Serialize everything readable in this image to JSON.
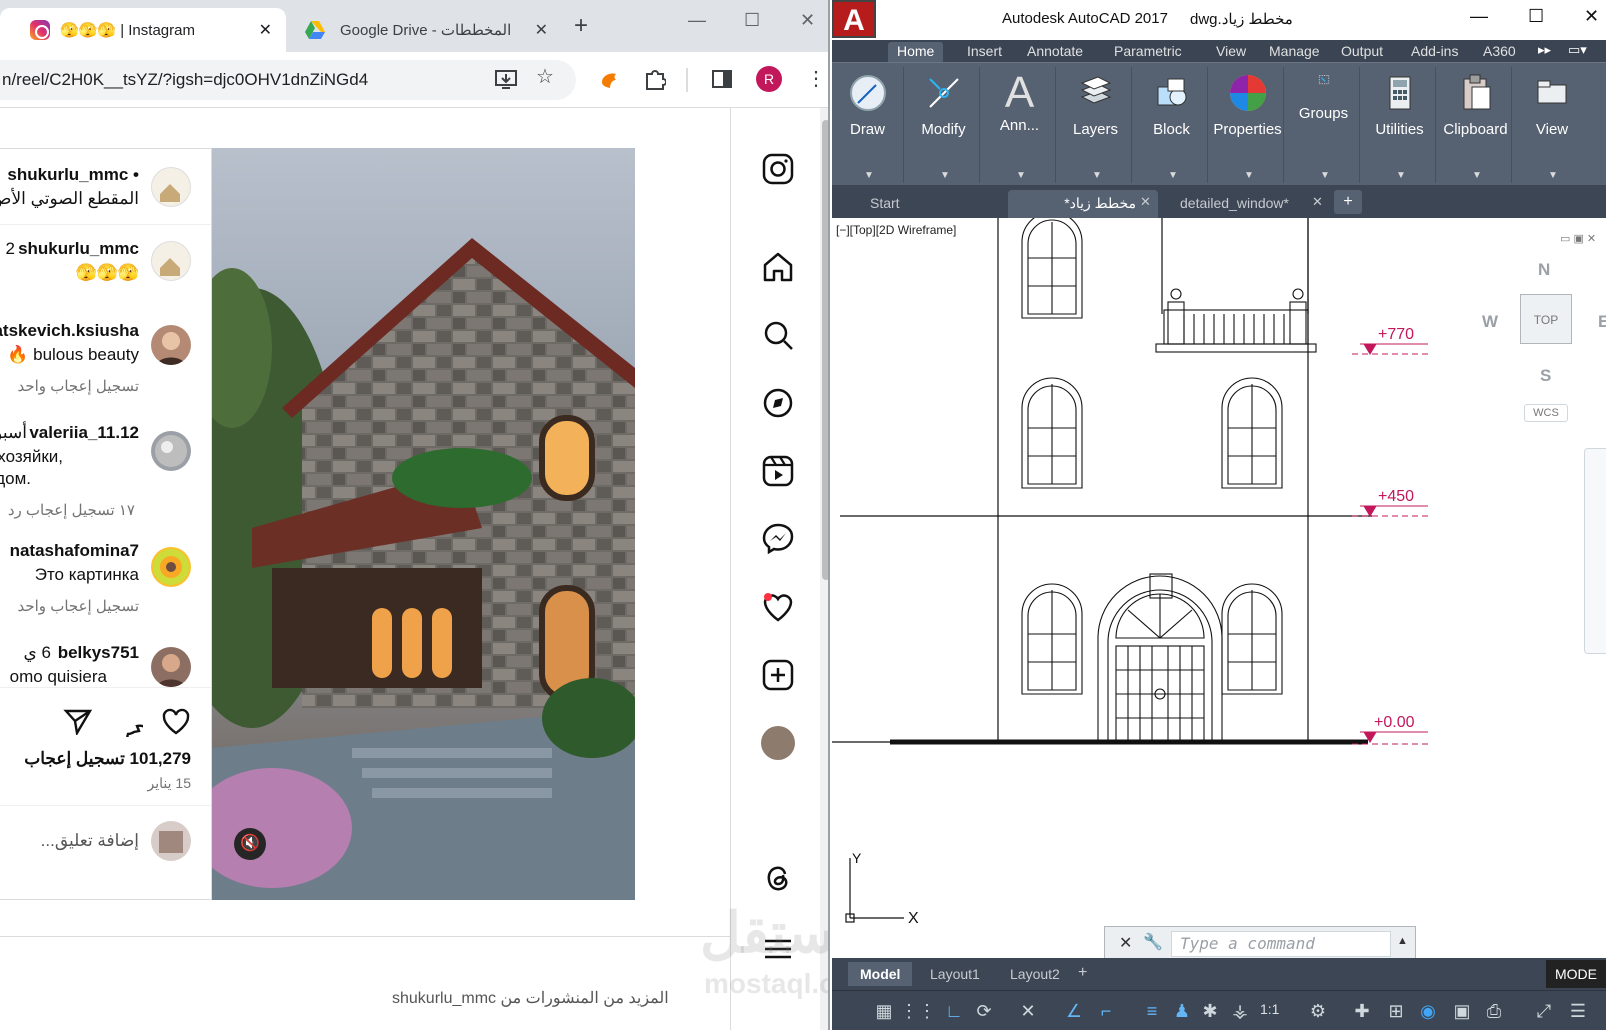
{
  "browser": {
    "tabs": [
      {
        "title": "🫣🫣🫣 | Instagram",
        "close": "✕"
      },
      {
        "title": "Google Drive - المخططات",
        "close": "✕"
      }
    ],
    "new_tab": "+",
    "window_controls": [
      "—",
      "☐",
      "✕"
    ],
    "url": "n/reel/C2H0K__tsYZ/?igsh=djc0OHV1dnZiNGd4",
    "profile_initial": "R"
  },
  "instagram": {
    "comments": [
      {
        "user": "shukurlu_mmc •",
        "text": "المقطع الصوتي الأص",
        "meta": ""
      },
      {
        "user": "shukurlu_mmc",
        "prefix": "2",
        "text": "🫣🫣🫣",
        "meta": ""
      },
      {
        "user": "atskevich.ksiusha",
        "text": "bulous beauty 🔥",
        "meta": "تسجيل إعجاب واحد"
      },
      {
        "user": "valeriia_11.12",
        "suffix": "أسبو",
        "text": "хозяйки,",
        "text2": "дом.",
        "meta": "١٧ تسجيل إعجاب   رد"
      },
      {
        "user": "natashafomina7",
        "text": "Это картинка",
        "meta": "تسجيل إعجاب واحد"
      },
      {
        "user": "belkys751",
        "suffix": "6 ي",
        "text": "omo quisiera",
        "meta": ""
      }
    ],
    "likes": "101,279 تسجيل إعجاب",
    "date": "15 يناير",
    "add_comment_placeholder": "إضافة تعليق...",
    "more_posts": "المزيد من المنشورات من shukurlu_mmc",
    "sidebar_icons": [
      "instagram-icon",
      "home-icon",
      "search-icon",
      "explore-icon",
      "reels-icon",
      "messenger-icon",
      "notifications-icon",
      "create-icon",
      "profile-icon",
      "threads-icon",
      "more-icon"
    ]
  },
  "autocad": {
    "title": "Autodesk AutoCAD 2017",
    "file": "مخطط زياد.dwg",
    "ribbon_tabs": [
      "Home",
      "Insert",
      "Annotate",
      "Parametric",
      "View",
      "Manage",
      "Output",
      "Add-ins",
      "A360"
    ],
    "panels": [
      "Draw",
      "Modify",
      "Ann...",
      "Layers",
      "Block",
      "Properties",
      "Groups",
      "Utilities",
      "Clipboard",
      "View"
    ],
    "doc_tabs": [
      "Start",
      "مخطط زياد*",
      "detailed_window*"
    ],
    "viewport_label": "[−][Top][2D Wireframe]",
    "levels": [
      "+770",
      "+450",
      "+0.00"
    ],
    "viewcube": {
      "n": "N",
      "s": "S",
      "e": "E",
      "w": "W",
      "top": "TOP",
      "wcs": "WCS"
    },
    "axis": {
      "x": "X",
      "y": "Y"
    },
    "command_placeholder": "Type a command",
    "layout_tabs": [
      "Model",
      "Layout1",
      "Layout2"
    ],
    "scale": "1:1",
    "mode": "MODE"
  },
  "watermark": {
    "line1": "مستقل",
    "line2": "mostaql.com"
  }
}
